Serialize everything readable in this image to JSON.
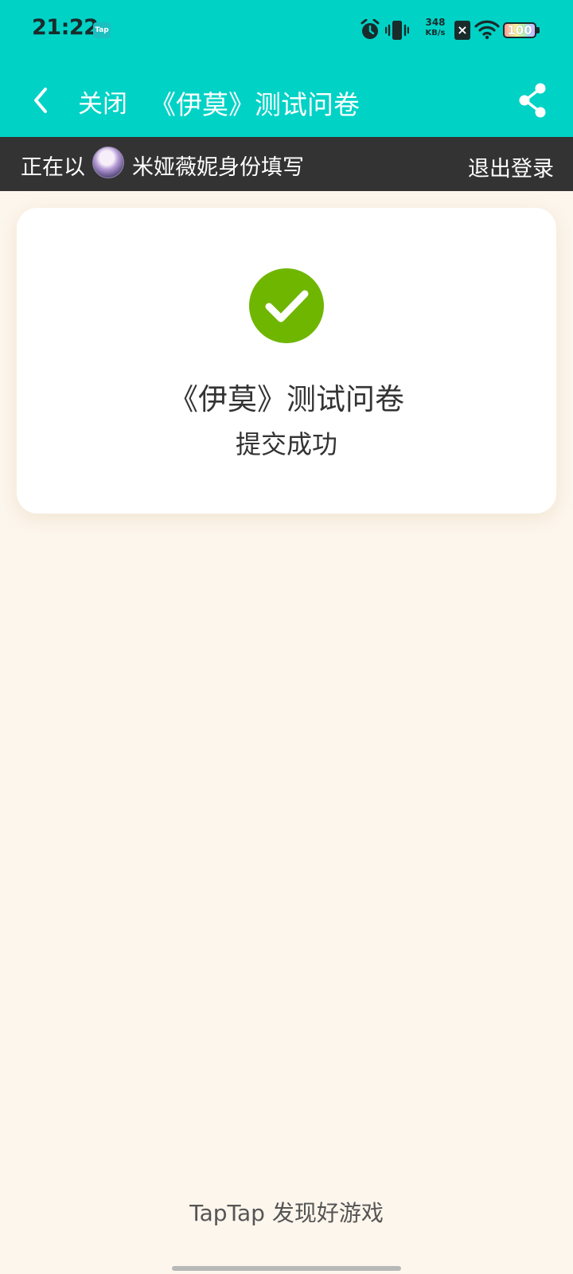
{
  "status_bar": {
    "time": "21:22",
    "app_badge": "Tap",
    "net_speed_value": "348",
    "net_speed_unit": "KB/s",
    "battery": "100",
    "icons": [
      "alarm-icon",
      "vibrate-icon",
      "no-sim-icon",
      "wifi-icon",
      "battery-icon"
    ]
  },
  "app_bar": {
    "close_label": "关闭",
    "title": "《伊莫》测试问卷",
    "icons": [
      "back-arrow-icon",
      "share-icon"
    ],
    "background_color": "#00d2c6"
  },
  "identity_bar": {
    "prefix": "正在以",
    "name_suffix": "米娅薇妮身份填写",
    "logout": "退出登录",
    "background_color": "#333333"
  },
  "result": {
    "title": "《伊莫》测试问卷",
    "message": "提交成功",
    "icon": "check-circle-icon",
    "icon_color": "#6fb600"
  },
  "footer": {
    "brand": "TapTap 发现好游戏"
  }
}
